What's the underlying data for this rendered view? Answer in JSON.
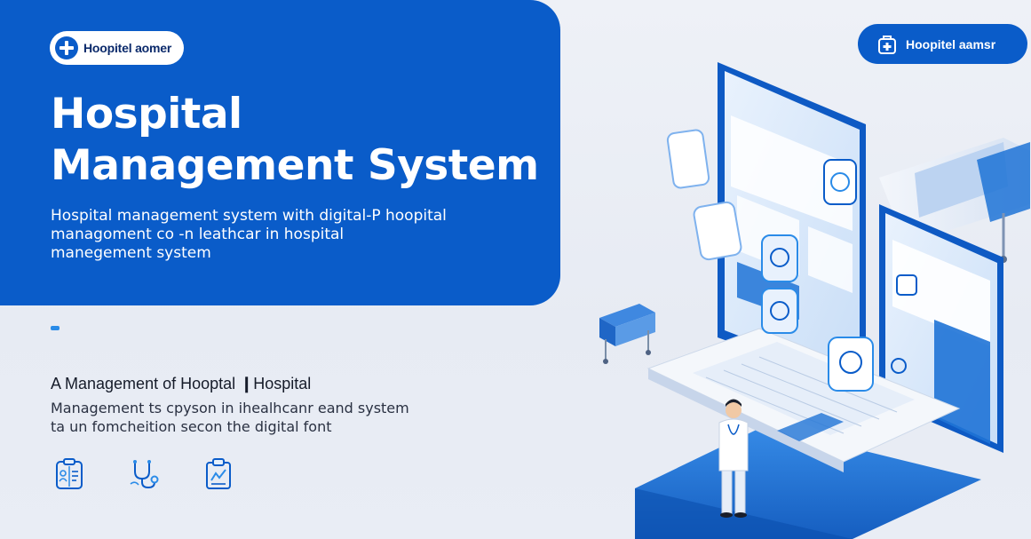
{
  "brand": {
    "label": "Hoopitel aomer",
    "icon": "plus-cross-icon"
  },
  "top_badge": {
    "label": "Hoopitel aamsr",
    "icon": "medical-kit-icon"
  },
  "hero": {
    "title_line1": "Hospital",
    "title_line2": "Management System",
    "subtitle_line1": "Hospital management system with digital-P hoopital",
    "subtitle_line2": "managoment co -n leathcar in hospital",
    "subtitle_line3": "manegement system"
  },
  "section": {
    "title": "A Management of Hooptal ❙Hospital",
    "body_line1": "Management ts cpyson in  ihealhcanr eand  system",
    "body_line2": "ta un fomcheition  secon the digital font"
  },
  "feature_icons": [
    "patient-record-icon",
    "stethoscope-icon",
    "clipboard-icon"
  ],
  "colors": {
    "primary": "#0a5cc9",
    "accent": "#2a8be8",
    "background": "#eef1f7",
    "dark_text": "#161c2a"
  }
}
